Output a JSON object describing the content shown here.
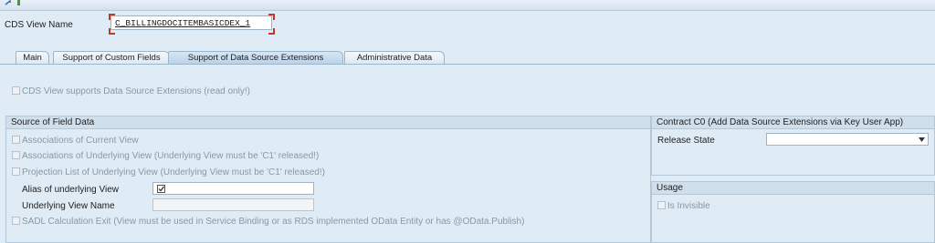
{
  "header": {
    "cds_view_label": "CDS View Name",
    "cds_view_value": "C_BILLINGDOCITEMBASICDEX_1"
  },
  "tabs": [
    {
      "label": "Main"
    },
    {
      "label": "Support of Custom Fields"
    },
    {
      "label": "Support of Data Source Extensions"
    },
    {
      "label": "Administrative Data"
    }
  ],
  "active_tab": "Support of Data Source Extensions",
  "main": {
    "supports_extensions_label": "CDS View supports Data Source Extensions (read only!)"
  },
  "source_group": {
    "title": "Source of Field Data",
    "assoc_current": "Associations of Current View",
    "assoc_underlying": "Associations of Underlying View (Underlying View must be 'C1' released!)",
    "projection_list": "Projection List of Underlying View (Underlying View must be 'C1' released!)",
    "alias_label": "Alias of underlying View",
    "alias_checked": true,
    "underlying_name_label": "Underlying View Name",
    "sadl_label": "SADL Calculation Exit (View must be used in Service Binding or as RDS implemented OData Entity or has @OData.Publish)"
  },
  "contract_group": {
    "title": "Contract C0 (Add Data Source Extensions via Key User App)",
    "release_state_label": "Release State",
    "release_state_value": ""
  },
  "usage_group": {
    "title": "Usage",
    "is_invisible_label": "Is Invisible"
  },
  "colors": {
    "background": "#dfebf5",
    "group_header": "#d0dfec",
    "border": "#9db5cb",
    "required_marker": "#c0392b"
  }
}
